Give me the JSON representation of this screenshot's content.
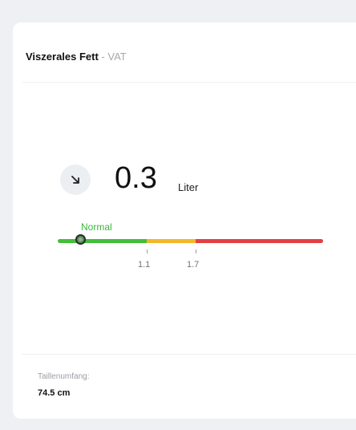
{
  "card": {
    "title": "Viszerales Fett",
    "separator": " - ",
    "subtitle": "VAT"
  },
  "measurement": {
    "value": "0.3",
    "unit": "Liter",
    "trend_icon": "arrow-down-right-icon"
  },
  "scale": {
    "current_label": "Normal",
    "current_value": 0.3,
    "thresholds": [
      "1.1",
      "1.7"
    ],
    "segments": [
      {
        "name": "normal",
        "color": "#44be3c"
      },
      {
        "name": "elevated",
        "color": "#f2b82a"
      },
      {
        "name": "high",
        "color": "#e24143"
      }
    ]
  },
  "footer": {
    "label": "Taillenumfang:",
    "value": "74.5 cm"
  }
}
